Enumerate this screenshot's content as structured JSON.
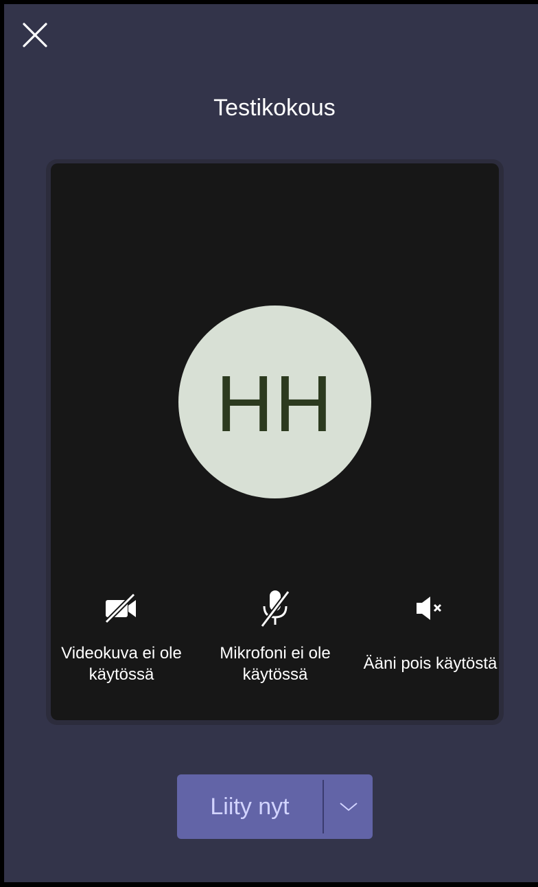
{
  "meeting": {
    "title": "Testikokous"
  },
  "avatar": {
    "initials": "HH"
  },
  "controls": {
    "video_label": "Videokuva ei ole käytössä",
    "mic_label": "Mikrofoni ei ole käytössä",
    "speaker_label": "Ääni pois käytöstä"
  },
  "join": {
    "label": "Liity nyt"
  },
  "icons": {
    "close": "close-icon",
    "video": "video-off-icon",
    "mic": "mic-off-icon",
    "speaker": "speaker-muted-icon",
    "dropdown": "chevron-down-icon"
  },
  "colors": {
    "background": "#33344a",
    "preview": "#171717",
    "avatar_bg": "#d8e0d5",
    "avatar_text": "#2c3a1f",
    "join_button": "#6264a7",
    "join_text": "#d2d4ff"
  }
}
